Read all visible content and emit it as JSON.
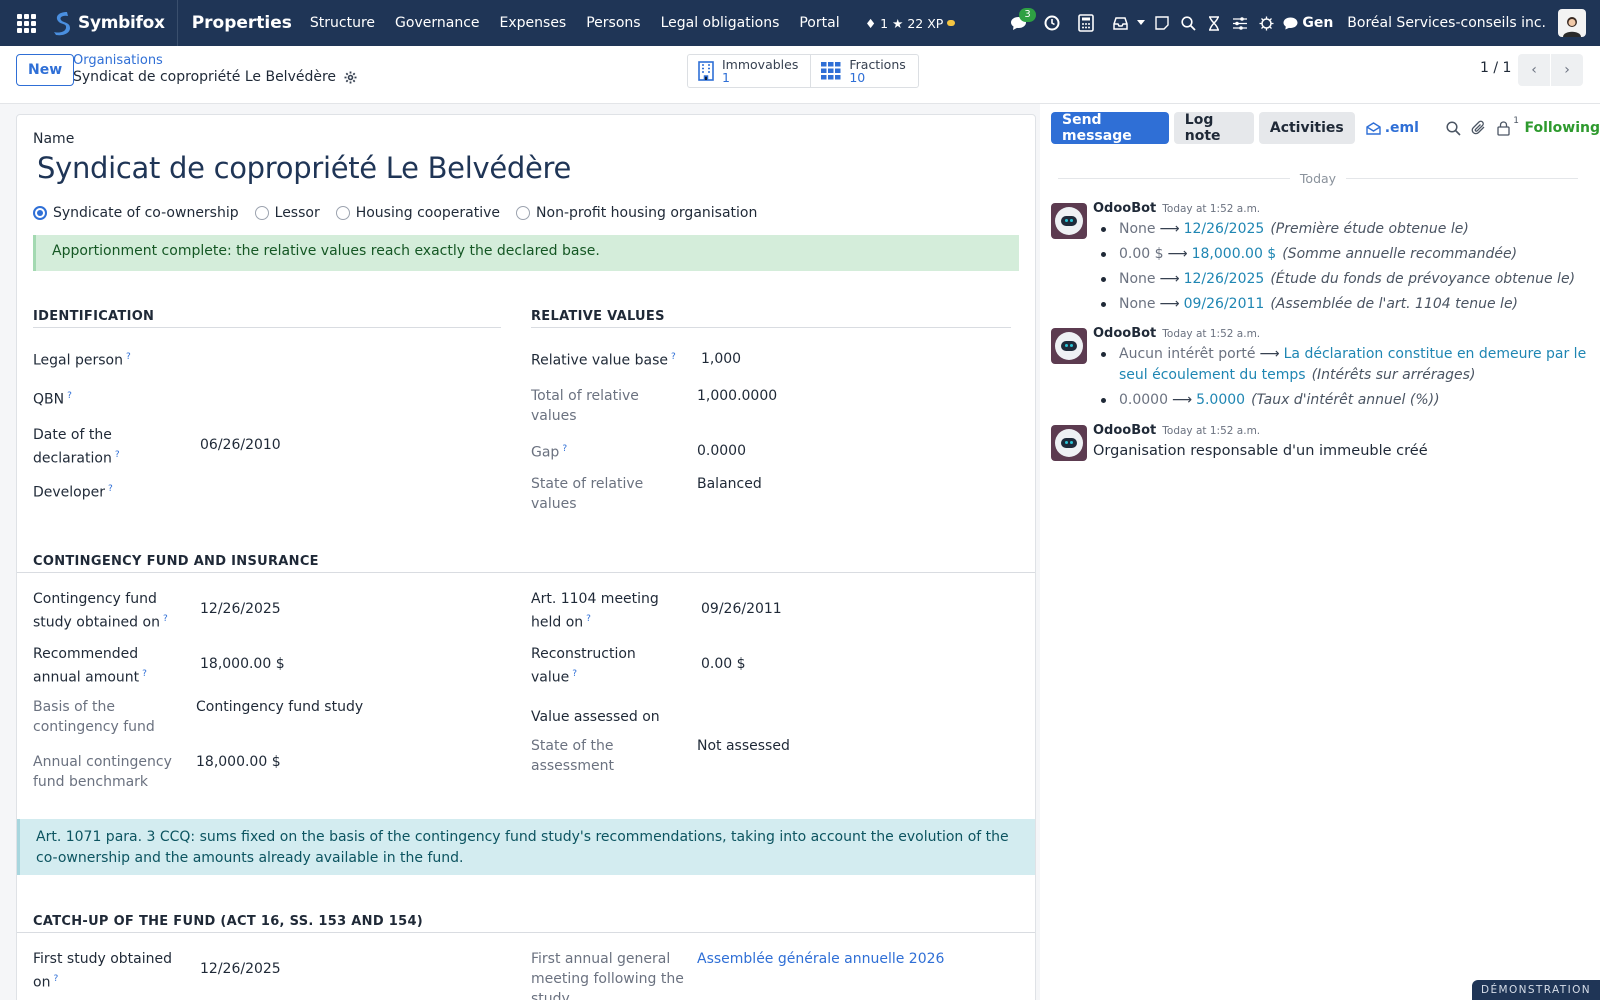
{
  "nav": {
    "brand": "Symbifox",
    "app": "Properties",
    "menu": [
      "Structure",
      "Governance",
      "Expenses",
      "Persons",
      "Legal obligations",
      "Portal"
    ],
    "xp_level": "1",
    "xp_points": "22 XP",
    "messages_count": "3",
    "gen_label": "Gen",
    "company": "Boréal Services-conseils inc."
  },
  "control": {
    "new_label": "New",
    "breadcrumb_parent": "Organisations",
    "breadcrumb_current": "Syndicat de copropriété Le Belvédère",
    "smart_buttons": [
      {
        "label": "Immovables",
        "value": "1",
        "icon": "building-icon"
      },
      {
        "label": "Fractions",
        "value": "10",
        "icon": "grid-icon"
      }
    ],
    "pager": "1 / 1"
  },
  "form": {
    "name_label": "Name",
    "title": "Syndicat de copropriété Le Belvédère",
    "org_type_options": [
      "Syndicate of co-ownership",
      "Lessor",
      "Housing cooperative",
      "Non-profit housing organisation"
    ],
    "org_type_selected": "Syndicate of co-ownership",
    "apportionment_alert": "Apportionment complete: the relative values reach exactly the declared base.",
    "identification": {
      "title": "IDENTIFICATION",
      "legal_person_label": "Legal person",
      "qbn_label": "QBN",
      "declaration_date_label_1": "Date of the",
      "declaration_date_label_2": "declaration",
      "declaration_date": "06/26/2010",
      "developer_label": "Developer"
    },
    "relative_values": {
      "title": "RELATIVE VALUES",
      "base_label": "Relative value base",
      "base": "1,000",
      "total_label_1": "Total of relative",
      "total_label_2": "values",
      "total": "1,000.0000",
      "gap_label": "Gap",
      "gap": "0.0000",
      "state_label_1": "State of relative",
      "state_label_2": "values",
      "state": "Balanced"
    },
    "contingency": {
      "title": "CONTINGENCY FUND AND INSURANCE",
      "study_label_1": "Contingency fund",
      "study_label_2": "study obtained on",
      "study_date": "12/26/2025",
      "recommended_label_1": "Recommended",
      "recommended_label_2": "annual amount",
      "recommended": "18,000.00 $",
      "basis_label_1": "Basis of the",
      "basis_label_2": "contingency fund",
      "basis": "Contingency fund study",
      "benchmark_label_1": "Annual contingency",
      "benchmark_label_2": "fund benchmark",
      "benchmark": "18,000.00 $",
      "meeting_label_1": "Art. 1104 meeting",
      "meeting_label_2": "held on",
      "meeting_date": "09/26/2011",
      "reconstruction_label_1": "Reconstruction",
      "reconstruction_label_2": "value",
      "reconstruction": "0.00 $",
      "assessed_label": "Value assessed on",
      "assessment_state_label_1": "State of the",
      "assessment_state_label_2": "assessment",
      "assessment_state": "Not assessed"
    },
    "info_alert": "Art. 1071 para. 3 CCQ: sums fixed on the basis of the contingency fund study's recommendations, taking into account the evolution of the co-ownership and the amounts already available in the fund.",
    "catchup": {
      "title": "CATCH-UP OF THE FUND (ACT 16, SS. 153 AND 154)",
      "first_study_label_1": "First study obtained",
      "first_study_label_2": "on",
      "first_study_date": "12/26/2025",
      "first_meeting_label_1": "First annual general",
      "first_meeting_label_2": "meeting following the",
      "first_meeting_label_3": "study",
      "first_meeting": "Assemblée générale annuelle 2026"
    }
  },
  "chatter": {
    "send_message": "Send message",
    "log_note": "Log note",
    "activities": "Activities",
    "eml": ".eml",
    "followers_count": "1",
    "following": "Following",
    "today": "Today",
    "messages": [
      {
        "author": "OdooBot",
        "date": "Today at 1:52 a.m.",
        "changes": [
          {
            "old": "None",
            "new": "12/26/2025",
            "field": "(Première étude obtenue le)"
          },
          {
            "old": "0.00 $",
            "new": "18,000.00 $",
            "field": "(Somme annuelle recommandée)"
          },
          {
            "old": "None",
            "new": "12/26/2025",
            "field": "(Étude du fonds de prévoyance obtenue le)"
          },
          {
            "old": "None",
            "new": "09/26/2011",
            "field": "(Assemblée de l'art. 1104 tenue le)"
          }
        ]
      },
      {
        "author": "OdooBot",
        "date": "Today at 1:52 a.m.",
        "changes": [
          {
            "old": "Aucun intérêt porté",
            "new": "La déclaration constitue en demeure par le seul écoulement du temps",
            "field": "(Intérêts sur arrérages)"
          },
          {
            "old": "0.0000",
            "new": "5.0000",
            "field": "(Taux d'intérêt annuel (%))"
          }
        ]
      },
      {
        "author": "OdooBot",
        "date": "Today at 1:52 a.m.",
        "body": "Organisation responsable d'un immeuble créé"
      }
    ]
  },
  "ribbon": "DÉMONSTRATION",
  "colors": {
    "nav_bg": "#1f3556",
    "primary": "#2f6fd6",
    "success_bg": "#d4edda",
    "info_bg": "#d3ecf0"
  }
}
